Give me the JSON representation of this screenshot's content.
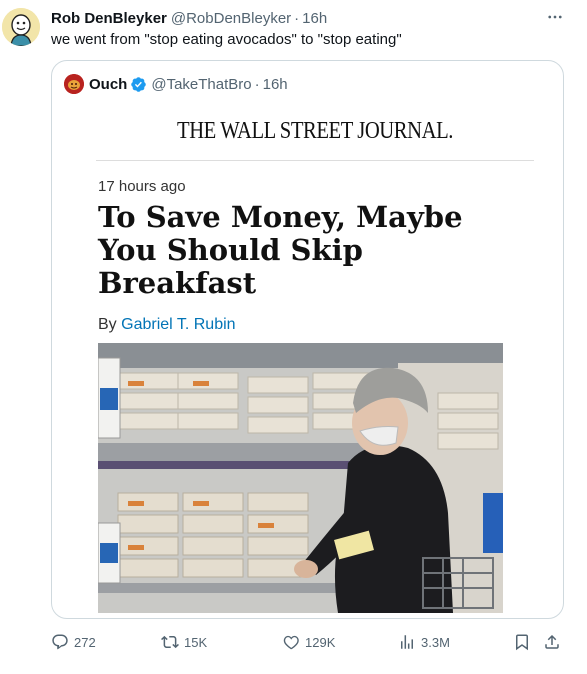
{
  "tweet": {
    "author_name": "Rob DenBleyker",
    "author_handle": "@RobDenBleyker",
    "separator": "·",
    "time": "16h",
    "text": "we went from \"stop eating avocados\" to \"stop eating\"",
    "more_icon": "more-horizontal-icon"
  },
  "quote": {
    "author_name": "Ouch",
    "verified_icon": "verified-badge-icon",
    "author_handle": "@TakeThatBro",
    "separator": "·",
    "time": "16h",
    "article": {
      "publication": "THE WALL STREET JOURNAL.",
      "posted": "17 hours ago",
      "headline": "To Save Money, Maybe You Should Skip Breakfast",
      "byline_prefix": "By",
      "byline_author": "Gabriel T. Rubin",
      "photo_subject": "shopper-in-egg-aisle-photo"
    }
  },
  "actions": {
    "reply": {
      "icon": "reply-icon",
      "count": "272"
    },
    "repost": {
      "icon": "repost-icon",
      "count": "15K"
    },
    "like": {
      "icon": "like-icon",
      "count": "129K"
    },
    "views": {
      "icon": "views-icon",
      "count": "3.3M"
    },
    "bookmark": {
      "icon": "bookmark-icon"
    },
    "share": {
      "icon": "share-icon"
    }
  },
  "colors": {
    "text_primary": "#0f1419",
    "text_secondary": "#536471",
    "border": "#cfd9de",
    "verified_blue": "#1d9bf0",
    "byline_link": "#0274b6"
  }
}
